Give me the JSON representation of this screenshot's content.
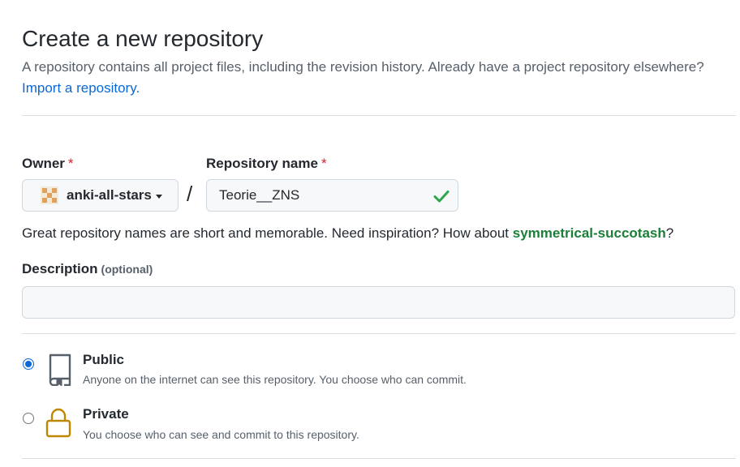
{
  "header": {
    "title": "Create a new repository",
    "subtitle": "A repository contains all project files, including the revision history. Already have a project repository elsewhere?",
    "import_link": "Import a repository."
  },
  "owner": {
    "label": "Owner",
    "required_mark": "*",
    "value": "anki-all-stars",
    "avatar_icon": "identicon-avatar"
  },
  "separator": "/",
  "repo_name": {
    "label": "Repository name",
    "required_mark": "*",
    "value": "Teorie__ZNS",
    "status_icon": "check-icon",
    "status_color": "#2da44e"
  },
  "hint": {
    "text": "Great repository names are short and memorable. Need inspiration? How about ",
    "suggestion": "symmetrical-succotash",
    "suffix": "?"
  },
  "description": {
    "label": "Description",
    "optional_label": "(optional)",
    "value": ""
  },
  "visibility": {
    "options": [
      {
        "title": "Public",
        "description": "Anyone on the internet can see this repository. You choose who can commit.",
        "icon": "repo-icon",
        "selected": true
      },
      {
        "title": "Private",
        "description": "You choose who can see and commit to this repository.",
        "icon": "lock-icon",
        "selected": false
      }
    ]
  },
  "colors": {
    "link": "#0969da",
    "suggestion": "#1a7f37",
    "required": "#cf222e",
    "lock_icon": "#bf8700"
  }
}
